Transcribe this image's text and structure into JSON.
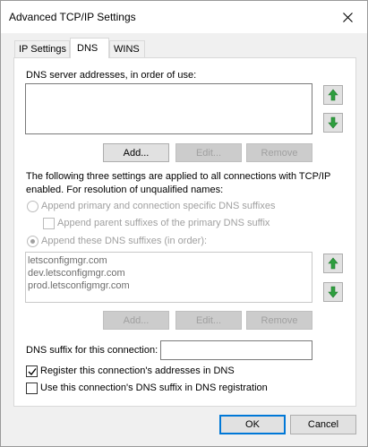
{
  "window": {
    "title": "Advanced TCP/IP Settings"
  },
  "tabs": [
    {
      "label": "IP Settings",
      "active": false
    },
    {
      "label": "DNS",
      "active": true
    },
    {
      "label": "WINS",
      "active": false
    }
  ],
  "dns": {
    "servers_label": "DNS server addresses, in order of use:",
    "servers": [],
    "server_buttons": {
      "add": "Add...",
      "edit": "Edit...",
      "remove": "Remove"
    },
    "info_text": "The following three settings are applied to all connections with TCP/IP enabled. For resolution of unqualified names:",
    "radio_primary": {
      "label": "Append primary and connection specific DNS suffixes",
      "checked": false,
      "enabled": false
    },
    "check_parent": {
      "label": "Append parent suffixes of the primary DNS suffix",
      "checked": false,
      "enabled": false
    },
    "radio_these": {
      "label": "Append these DNS suffixes (in order):",
      "checked": true,
      "enabled": false
    },
    "suffixes": [
      "letsconfigmgr.com",
      "dev.letsconfigmgr.com",
      "prod.letsconfigmgr.com"
    ],
    "suffix_buttons": {
      "add": "Add...",
      "edit": "Edit...",
      "remove": "Remove"
    },
    "conn_suffix_label": "DNS suffix for this connection:",
    "conn_suffix_value": "",
    "register": {
      "label": "Register this connection's addresses in DNS",
      "checked": true
    },
    "use_suffix": {
      "label": "Use this connection's DNS suffix in DNS registration",
      "checked": false
    }
  },
  "footer": {
    "ok": "OK",
    "cancel": "Cancel"
  },
  "colors": {
    "arrow_green": "#2e9e3e",
    "accent": "#0078d7"
  }
}
